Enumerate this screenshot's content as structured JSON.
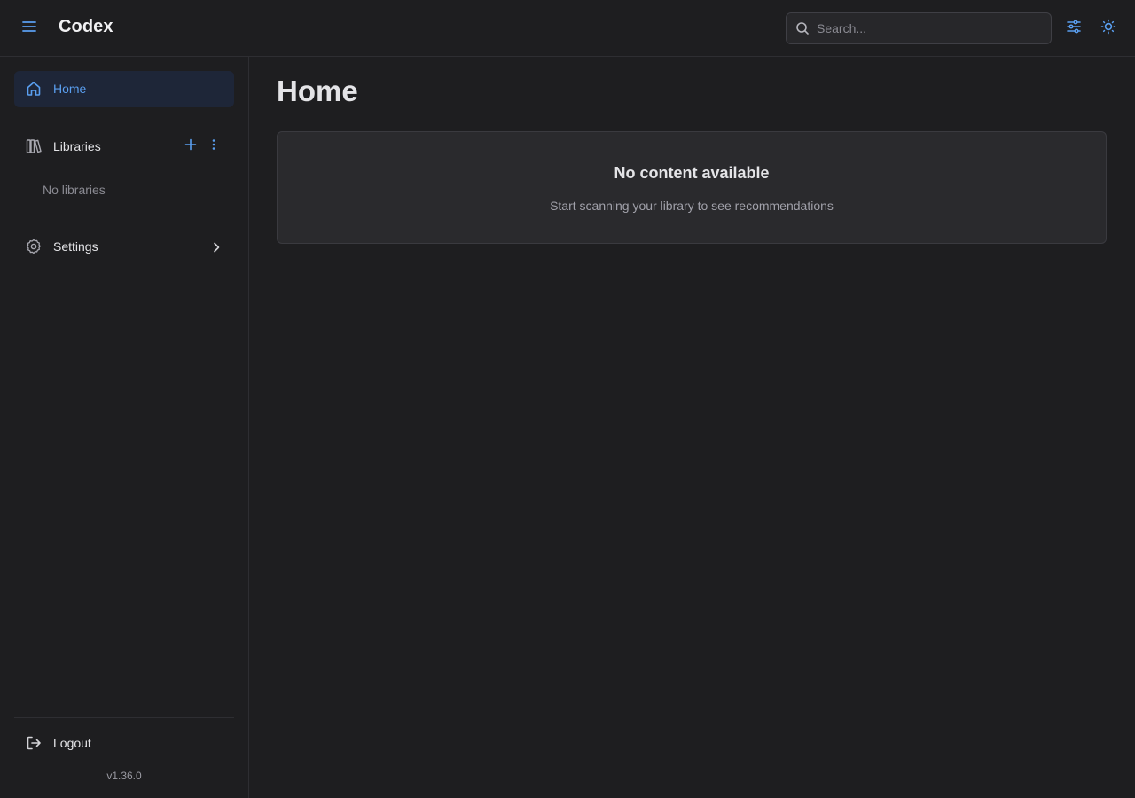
{
  "header": {
    "app_title": "Codex",
    "search": {
      "placeholder": "Search...",
      "value": ""
    },
    "icons": [
      "menu-icon",
      "search-icon",
      "sliders-icon",
      "sun-icon"
    ]
  },
  "sidebar": {
    "home_label": "Home",
    "libraries_label": "Libraries",
    "no_libraries_text": "No libraries",
    "settings_label": "Settings",
    "logout_label": "Logout",
    "version": "v1.36.0"
  },
  "main": {
    "page_title": "Home",
    "empty_state": {
      "title": "No content available",
      "subtitle": "Start scanning your library to see recommendations"
    }
  },
  "colors": {
    "background": "#1e1e20",
    "accent": "#5a9ff0",
    "active_nav_bg": "#1e2638",
    "card_bg": "#2a2a2d"
  }
}
